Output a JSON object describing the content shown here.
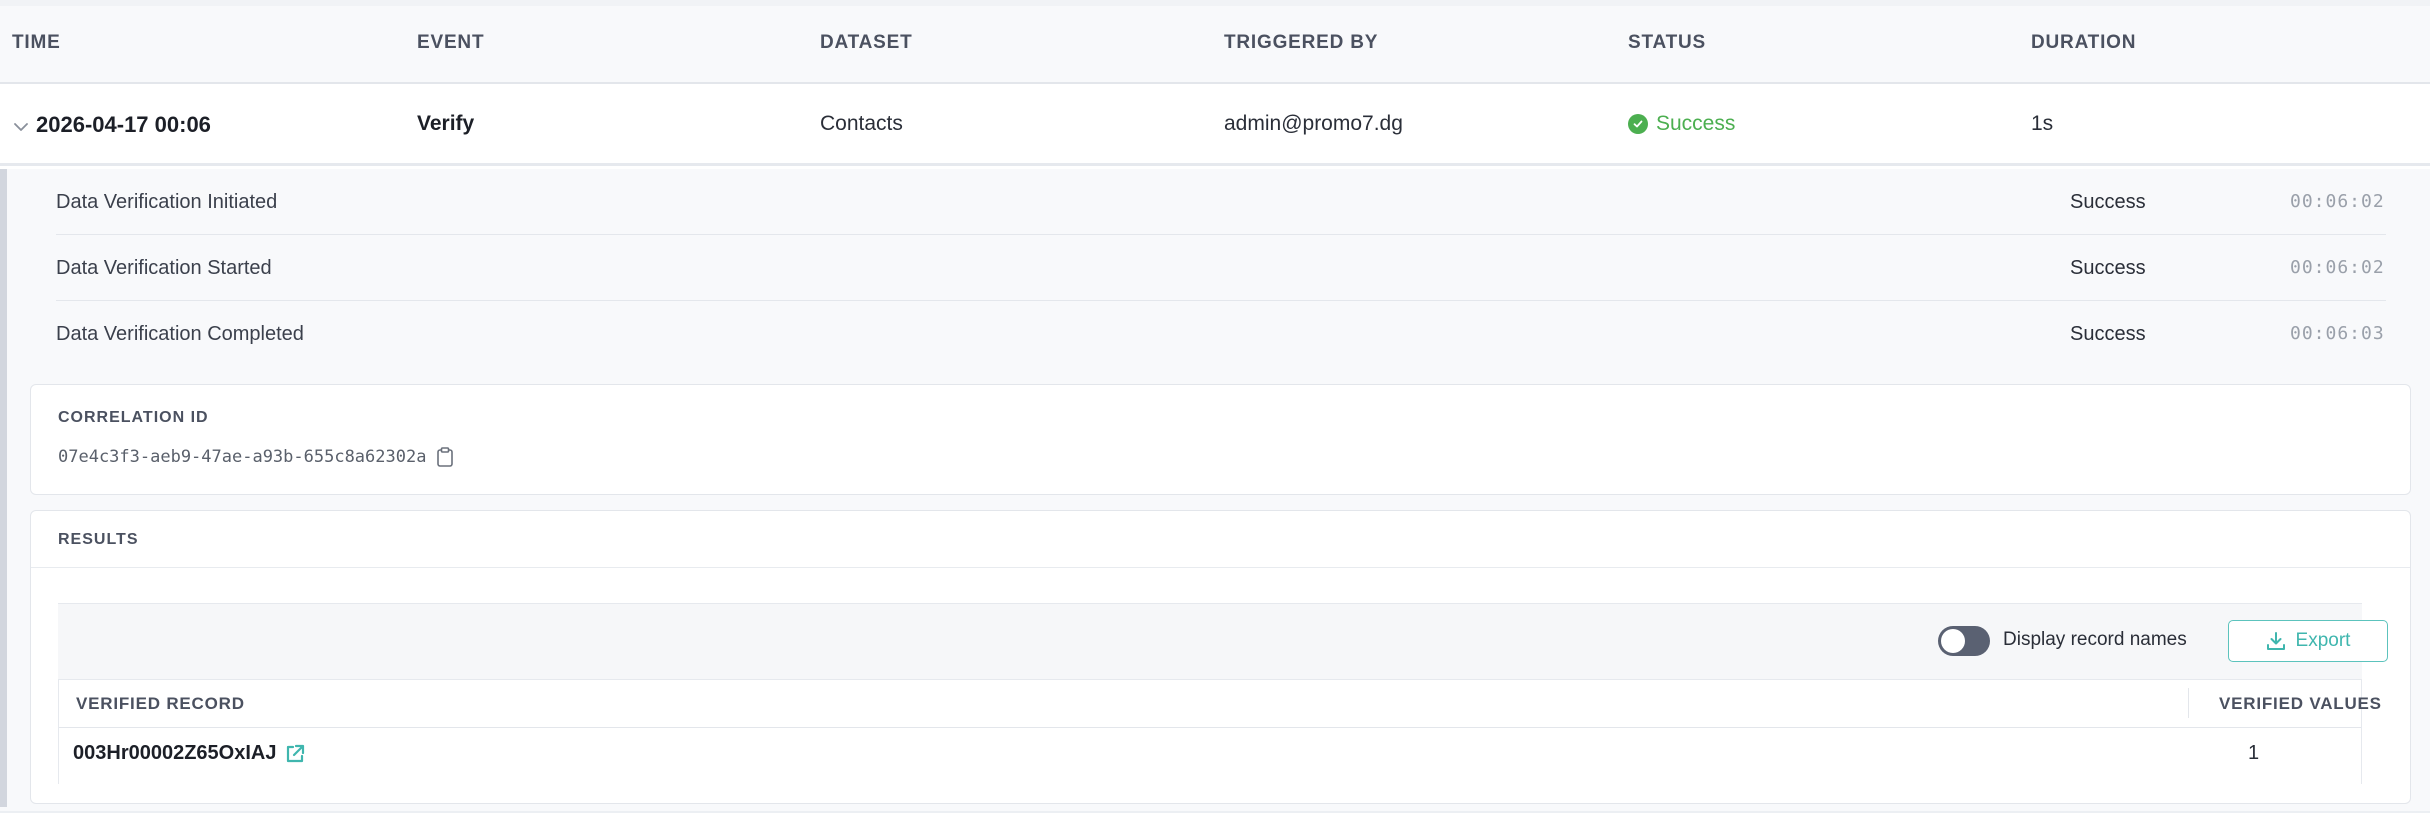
{
  "table": {
    "columns": [
      "TIME",
      "EVENT",
      "DATASET",
      "TRIGGERED BY",
      "STATUS",
      "DURATION"
    ],
    "row": {
      "time": "2026-04-17 00:06",
      "event": "Verify",
      "dataset": "Contacts",
      "triggered_by": "admin@promo7.dg",
      "status": "Success",
      "duration": "1s"
    }
  },
  "steps": [
    {
      "name": "Data Verification Initiated",
      "status": "Success",
      "time": "00:06:02"
    },
    {
      "name": "Data Verification Started",
      "status": "Success",
      "time": "00:06:02"
    },
    {
      "name": "Data Verification Completed",
      "status": "Success",
      "time": "00:06:03"
    }
  ],
  "correlation": {
    "label": "CORRELATION ID",
    "value": "07e4c3f3-aeb9-47ae-a93b-655c8a62302a"
  },
  "results": {
    "label": "RESULTS",
    "toggle_label": "Display record names",
    "toggle_on": false,
    "export_label": "Export",
    "columns": [
      "VERIFIED RECORD",
      "VERIFIED VALUES"
    ],
    "rows": [
      {
        "record": "003Hr00002Z65OxIAJ",
        "values": "1"
      }
    ]
  },
  "colors": {
    "success": "#4caf50",
    "accent": "#3fb6ae",
    "header_bg": "#f8f9fb"
  },
  "icons": [
    "chevron-down-icon",
    "check-circle-icon",
    "clipboard-icon",
    "download-icon",
    "external-link-icon"
  ]
}
